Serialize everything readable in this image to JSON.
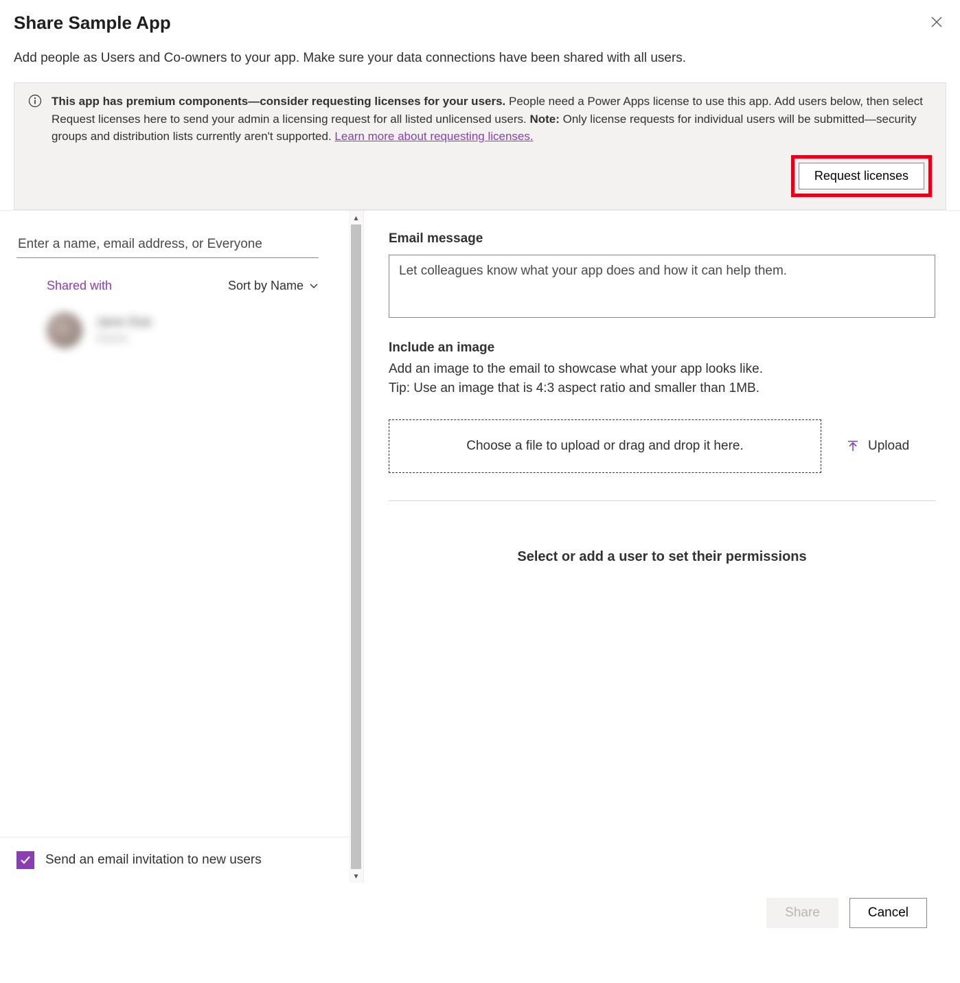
{
  "header": {
    "title": "Share Sample App",
    "subtitle": "Add people as Users and Co-owners to your app. Make sure your data connections have been shared with all users."
  },
  "banner": {
    "bold_1": "This app has premium components—consider requesting licenses for your users.",
    "text_1": " People need a Power Apps license to use this app. Add users below, then select Request licenses here to send your admin a licensing request for all listed unlicensed users. ",
    "bold_2": "Note:",
    "text_2": " Only license requests for individual users will be submitted—security groups and distribution lists currently aren't supported. ",
    "link": "Learn more about requesting licenses.",
    "button": "Request licenses"
  },
  "left": {
    "search_placeholder": "Enter a name, email address, or Everyone",
    "shared_with": "Shared with",
    "sort_label": "Sort by Name",
    "user_name": "Jane Doe",
    "user_type": "Owner",
    "email_checkbox_label": "Send an email invitation to new users"
  },
  "right": {
    "email_message_label": "Email message",
    "email_message_placeholder": "Let colleagues know what your app does and how it can help them.",
    "include_image_label": "Include an image",
    "include_image_line1": "Add an image to the email to showcase what your app looks like.",
    "include_image_line2": "Tip: Use an image that is 4:3 aspect ratio and smaller than 1MB.",
    "dropzone_text": "Choose a file to upload or drag and drop it here.",
    "upload_label": "Upload",
    "permissions_prompt": "Select or add a user to set their permissions"
  },
  "footer": {
    "share": "Share",
    "cancel": "Cancel"
  }
}
